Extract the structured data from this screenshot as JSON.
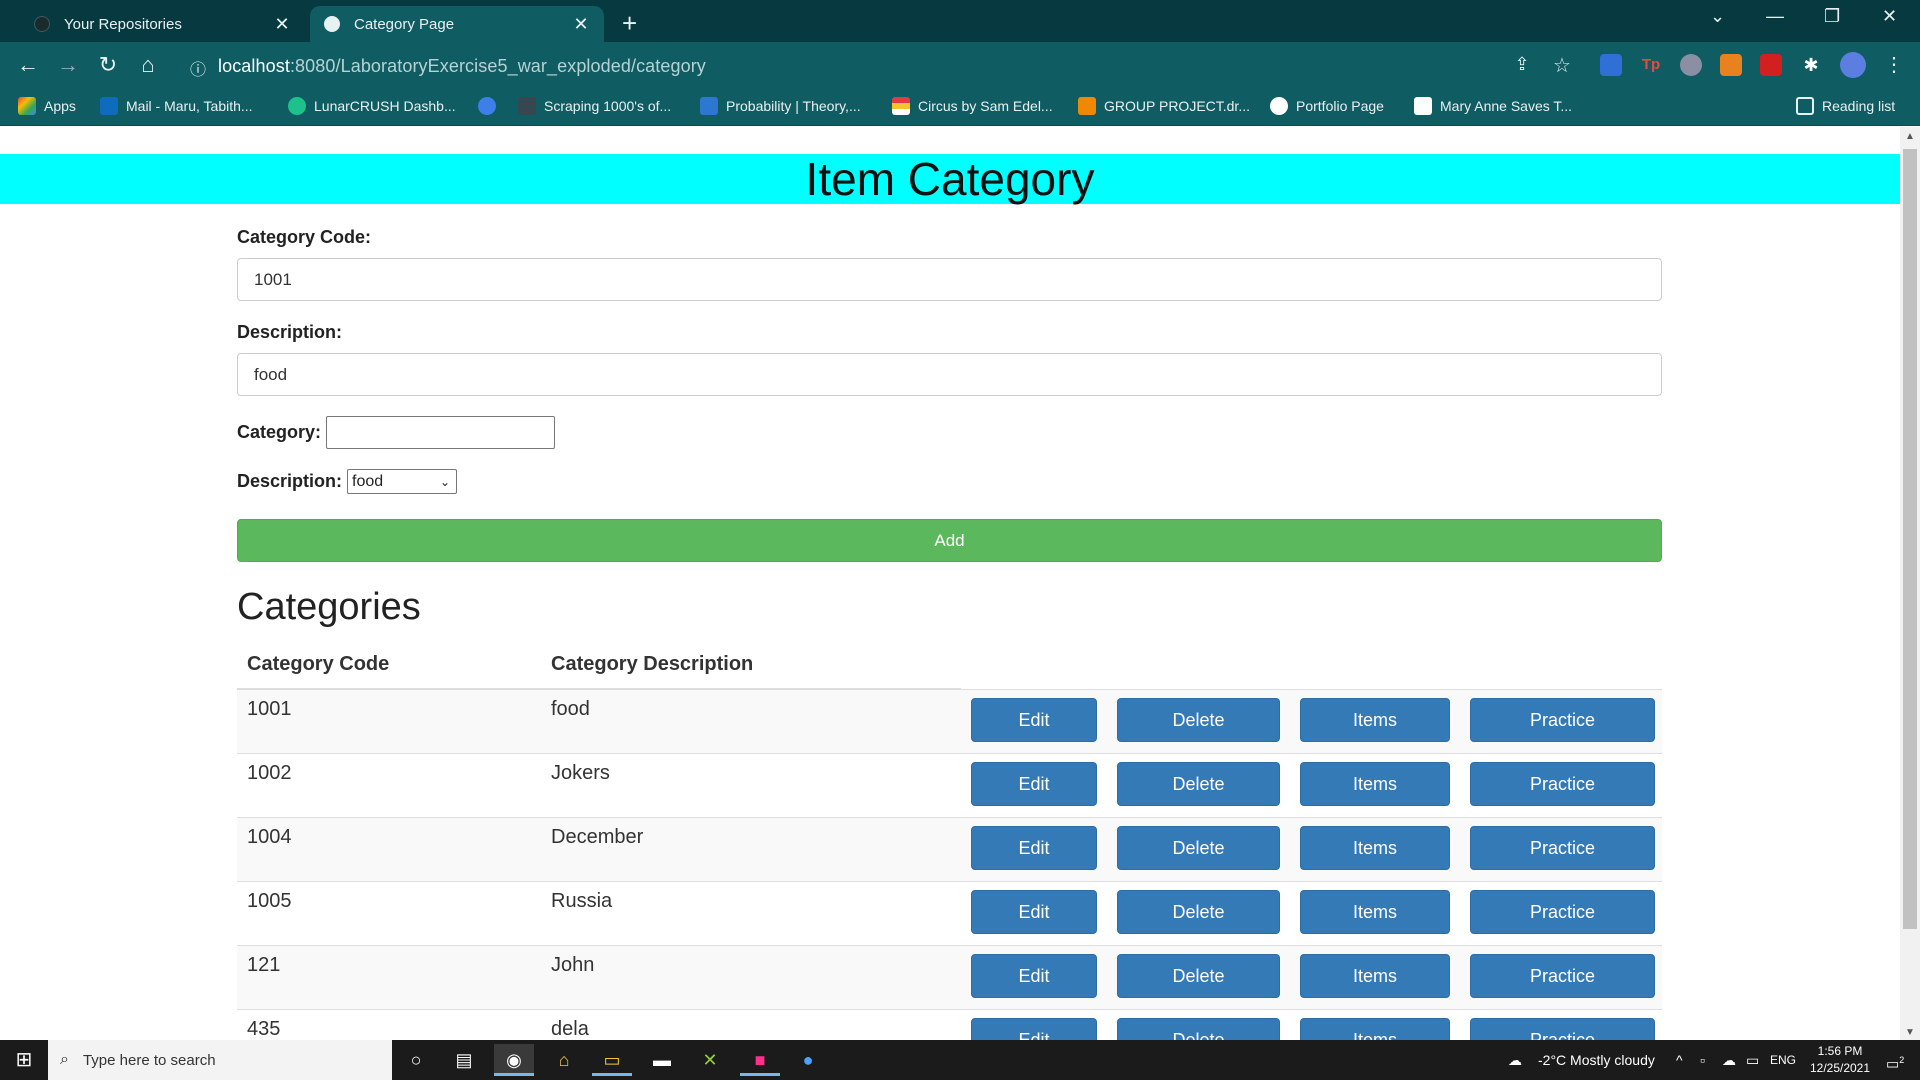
{
  "browser": {
    "tabs": [
      {
        "title": "Your Repositories",
        "active": false
      },
      {
        "title": "Category Page",
        "active": true
      }
    ],
    "url_host": "localhost",
    "url_path": ":8080/LaboratoryExercise5_war_exploded/category",
    "bookmarks": [
      "Apps",
      "Mail - Maru, Tabith...",
      "LunarCRUSH Dashb...",
      "Scraping 1000's of...",
      "Probability | Theory,...",
      "Circus by Sam Edel...",
      "GROUP PROJECT.dr...",
      "Portfolio Page",
      "Mary Anne Saves T..."
    ],
    "reading_list": "Reading list"
  },
  "page": {
    "header": "Item Category",
    "form": {
      "category_code_label": "Category Code:",
      "category_code_value": "1001",
      "description_label": "Description:",
      "description_value": "food",
      "category_label": "Category:",
      "category_value": "",
      "description_select_label": "Description:",
      "description_select_value": "food",
      "add_button": "Add"
    },
    "categories_title": "Categories",
    "table": {
      "headers": [
        "Category Code",
        "Category Description"
      ],
      "rows": [
        {
          "code": "1001",
          "description": "food"
        },
        {
          "code": "1002",
          "description": "Jokers"
        },
        {
          "code": "1004",
          "description": "December"
        },
        {
          "code": "1005",
          "description": "Russia"
        },
        {
          "code": "121",
          "description": "John"
        },
        {
          "code": "435",
          "description": "dela"
        }
      ],
      "actions": {
        "edit": "Edit",
        "delete": "Delete",
        "items": "Items",
        "practice": "Practice"
      }
    }
  },
  "taskbar": {
    "search_placeholder": "Type here to search",
    "weather": "-2°C  Mostly cloudy",
    "language": "ENG",
    "time": "1:56 PM",
    "date": "12/25/2021",
    "notifications": "2"
  },
  "colors": {
    "header_band": "#00ffff",
    "add_button": "#5cb85c",
    "action_button": "#337ab7",
    "chrome_frame": "#073a40",
    "chrome_toolbar": "#0f5c63"
  }
}
